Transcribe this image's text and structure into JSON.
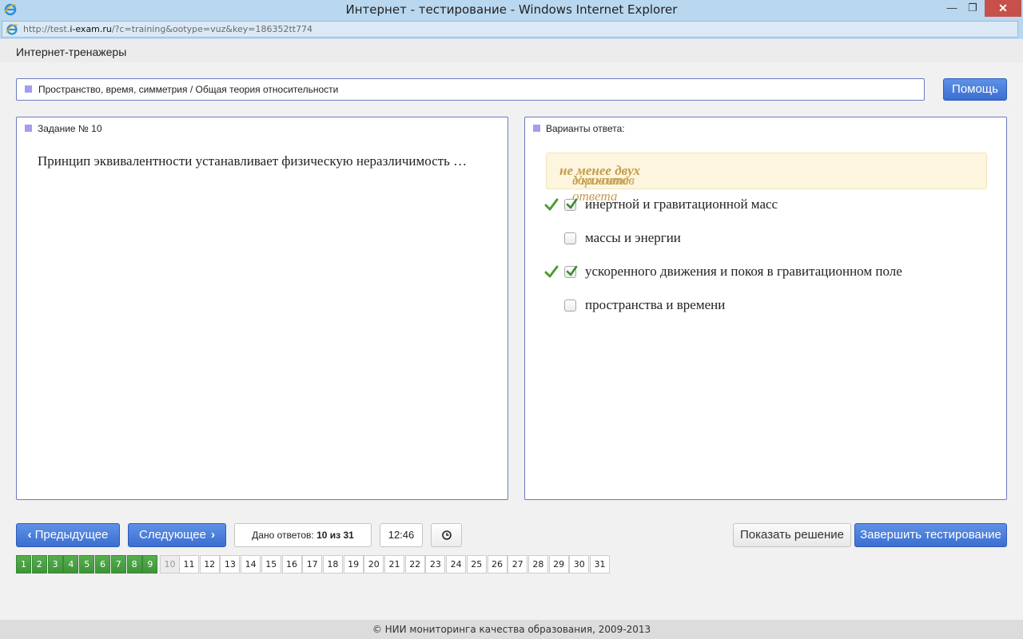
{
  "window": {
    "title": "Интернет - тестирование - Windows Internet Explorer",
    "min_glyph": "—",
    "max_glyph": "❐",
    "close_glyph": "✕"
  },
  "address": {
    "url_prefix": "http://test.",
    "url_domain": "i-exam.ru",
    "url_rest": "/?c=training&ootype=vuz&key=186352tt774"
  },
  "header": {
    "brand": "Интернет-тренажеры"
  },
  "topic": {
    "text": "Пространство, время, симметрия / Общая теория относительности"
  },
  "help_label": "Помощь",
  "question": {
    "heading": "Задание № 10",
    "text": "Принцип эквивалентности устанавливает физическую неразличимость …"
  },
  "answers": {
    "heading": "Варианты ответа:",
    "hint_pre": "Укажите ",
    "hint_bold": "не менее двух",
    "hint_post": " вариантов ответа",
    "options": [
      {
        "text": "инертной и гравитационной масс",
        "checked": true,
        "correct_mark": true
      },
      {
        "text": "массы и энергии",
        "checked": false,
        "correct_mark": false
      },
      {
        "text": "ускоренного движения и покоя в гравитационном поле",
        "checked": true,
        "correct_mark": true
      },
      {
        "text": "пространства и времени",
        "checked": false,
        "correct_mark": false
      }
    ]
  },
  "toolbar": {
    "prev_label": "Предыдущее",
    "next_label": "Следующее",
    "answered_label": "Дано ответов:",
    "answered_value": "10 из 31",
    "timer": "12:46",
    "show_solution_label": "Показать решение",
    "finish_label": "Завершить тестирование"
  },
  "question_nav": {
    "done": [
      "1",
      "2",
      "3",
      "4",
      "5",
      "6",
      "7",
      "8",
      "9"
    ],
    "current": "10",
    "pending": [
      "11",
      "12",
      "13",
      "14",
      "15",
      "16",
      "17",
      "18",
      "19",
      "20",
      "21",
      "22",
      "23",
      "24",
      "25",
      "26",
      "27",
      "28",
      "29",
      "30",
      "31"
    ]
  },
  "colors": {
    "accent_blue": "#3b6ed0",
    "done_green": "#45993f",
    "hint_text": "#c39c4e",
    "panel_border": "#6b7cc2"
  },
  "footer": {
    "text": "© НИИ мониторинга качества образования, 2009-2013"
  }
}
